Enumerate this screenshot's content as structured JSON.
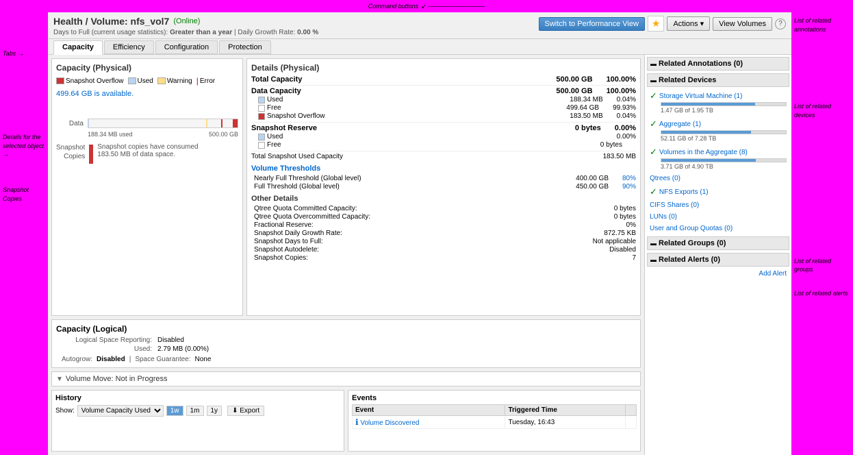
{
  "annotations": {
    "top": "Command buttons",
    "left_tabs": "Tabs",
    "left_details": "Details for the selected object",
    "left_snapshot": "Snapshot Copies",
    "right_annotations": "List of related annotations",
    "right_devices": "List of related devices",
    "right_groups": "List of related groups",
    "right_alerts": "List of related alerts"
  },
  "header": {
    "title": "Health / Volume: nfs_vol7",
    "status": "(Online)",
    "stats_label": "Days to Full (current usage statistics):",
    "stats_value": "Greater than a year",
    "stats_separator": "|",
    "growth_label": "Daily Growth Rate:",
    "growth_value": "0.00 %",
    "btn_performance": "Switch to Performance View",
    "btn_actions": "Actions ▾",
    "btn_volumes": "View Volumes"
  },
  "tabs": {
    "items": [
      "Capacity",
      "Efficiency",
      "Configuration",
      "Protection"
    ],
    "active": "Capacity"
  },
  "capacity_physical": {
    "title": "Capacity (Physical)",
    "legend": {
      "snapshot_overflow": "Snapshot Overflow",
      "used": "Used",
      "warning": "Warning",
      "error": "Error"
    },
    "available": "499.64 GB is available.",
    "data_label": "Data",
    "data_used": "188.34 MB used",
    "data_total": "500.00 GB",
    "snapshot_label": "Snapshot Copies",
    "snapshot_msg1": "Snapshot copies have consumed",
    "snapshot_msg2": "183.50 MB of data space."
  },
  "details_physical": {
    "title": "Details (Physical)",
    "total_capacity_label": "Total Capacity",
    "total_capacity_value": "500.00 GB",
    "total_capacity_pct": "100.00%",
    "data_capacity": {
      "label": "Data Capacity",
      "value": "500.00 GB",
      "pct": "100.00%",
      "used_label": "Used",
      "used_value": "188.34 MB",
      "used_pct": "0.04%",
      "free_label": "Free",
      "free_value": "499.64 GB",
      "free_pct": "99.93%",
      "snapshot_label": "Snapshot Overflow",
      "snapshot_value": "183.50 MB",
      "snapshot_pct": "0.04%"
    },
    "snapshot_reserve": {
      "label": "Snapshot Reserve",
      "value": "0 bytes",
      "pct": "0.00%",
      "used_label": "Used",
      "used_pct": "0.00%",
      "free_label": "Free",
      "free_value": "0 bytes"
    },
    "total_snapshot_label": "Total Snapshot Used Capacity",
    "total_snapshot_value": "183.50 MB",
    "thresholds_title": "Volume Thresholds",
    "nearly_full_label": "Nearly Full Threshold (Global level)",
    "nearly_full_value": "400.00 GB",
    "nearly_full_pct": "80%",
    "full_label": "Full Threshold (Global level)",
    "full_value": "450.00 GB",
    "full_pct": "90%",
    "other_title": "Other Details",
    "qtree_quota_committed_label": "Qtree Quota Committed Capacity:",
    "qtree_quota_committed_value": "0 bytes",
    "qtree_quota_overcommitted_label": "Qtree Quota Overcommitted Capacity:",
    "qtree_quota_overcommitted_value": "0 bytes",
    "fractional_label": "Fractional Reserve:",
    "fractional_value": "0%",
    "snapshot_daily_label": "Snapshot Daily Growth Rate:",
    "snapshot_daily_value": "872.75 KB",
    "snapshot_days_label": "Snapshot Days to Full:",
    "snapshot_days_value": "Not applicable",
    "snapshot_autodelete_label": "Snapshot Autodelete:",
    "snapshot_autodelete_value": "Disabled",
    "snapshot_copies_label": "Snapshot Copies:",
    "snapshot_copies_value": "7"
  },
  "capacity_logical": {
    "title": "Capacity (Logical)",
    "reporting_label": "Logical Space Reporting:",
    "reporting_value": "Disabled",
    "used_label": "Used:",
    "used_value": "2.79 MB (0.00%)",
    "autogrow_label": "Autogrow:",
    "autogrow_value": "Disabled",
    "space_guarantee_label": "Space Guarantee:",
    "space_guarantee_value": "None"
  },
  "volume_move": {
    "label": "Volume Move: Not in Progress"
  },
  "history": {
    "title": "History",
    "show_label": "Show:",
    "dropdown_value": "Volume Capacity Used",
    "time_buttons": [
      "1w",
      "1m",
      "1y"
    ],
    "active_time": "1w",
    "export_label": "⬇ Export"
  },
  "events": {
    "title": "Events",
    "col_event": "Event",
    "col_triggered": "Triggered Time",
    "rows": [
      {
        "type": "info",
        "event": "Volume Discovered",
        "triggered": "Tuesday, 16:43"
      }
    ]
  },
  "related_annotations": {
    "title": "Related Annotations (0)"
  },
  "related_devices": {
    "title": "Related Devices",
    "items": [
      {
        "label": "Storage Virtual Machine (1)",
        "progress": 75,
        "detail": "1.47 GB of 1.95 TB",
        "status": "ok"
      },
      {
        "label": "Aggregate (1)",
        "progress": 72,
        "detail": "52.11 GB of 7.28 TB",
        "status": "ok"
      },
      {
        "label": "Volumes in the Aggregate (8)",
        "progress": 76,
        "detail": "3.71 GB of 4.90 TB",
        "status": "ok"
      },
      {
        "label": "Qtrees (0)",
        "status": "none"
      },
      {
        "label": "NFS Exports (1)",
        "status": "ok"
      },
      {
        "label": "CIFS Shares (0)",
        "status": "none"
      },
      {
        "label": "LUNs (0)",
        "status": "none"
      },
      {
        "label": "User and Group Quotas (0)",
        "status": "none"
      }
    ]
  },
  "related_groups": {
    "title": "Related Groups (0)"
  },
  "related_alerts": {
    "title": "Related Alerts (0)",
    "add_alert": "Add Alert"
  }
}
